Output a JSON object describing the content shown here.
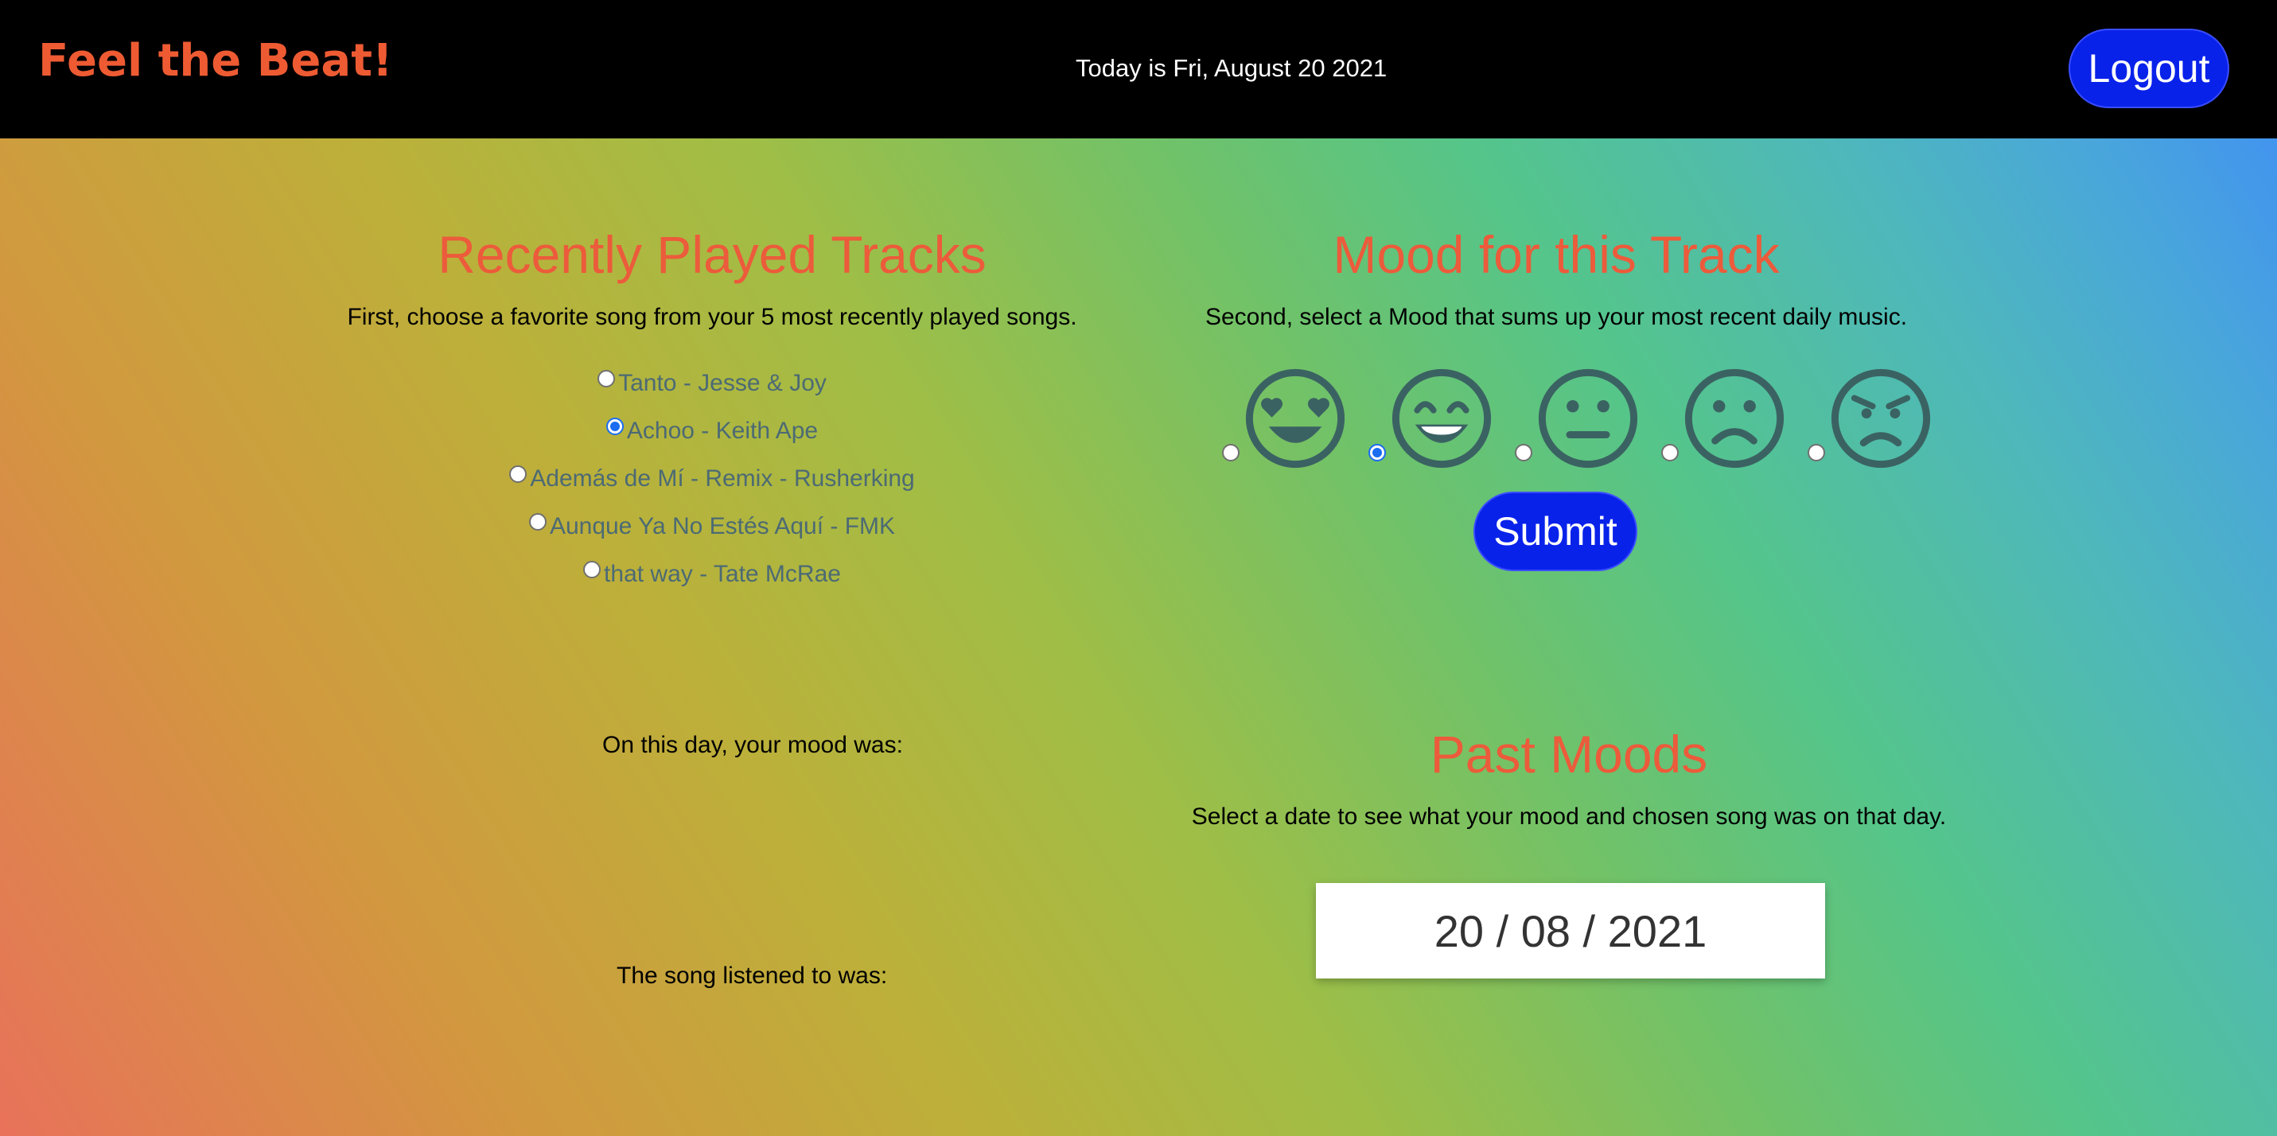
{
  "header": {
    "brand": "Feel the Beat!",
    "today_text": "Today is Fri, August 20 2021",
    "logout_label": "Logout"
  },
  "tracks_section": {
    "title": "Recently Played Tracks",
    "subtitle": "First, choose a favorite song from your 5 most recently played songs.",
    "tracks": [
      {
        "label": "Tanto - Jesse & Joy",
        "selected": false
      },
      {
        "label": "Achoo - Keith Ape",
        "selected": true
      },
      {
        "label": "Además de Mí - Remix - Rusherking",
        "selected": false
      },
      {
        "label": "Aunque Ya No Estés Aquí - FMK",
        "selected": false
      },
      {
        "label": "that way - Tate McRae",
        "selected": false
      }
    ]
  },
  "mood_section": {
    "title": "Mood for this Track",
    "subtitle": "Second, select a Mood that sums up your most recent daily music.",
    "moods": [
      {
        "icon": "heart-eyes-face-icon",
        "selected": false
      },
      {
        "icon": "grinning-face-icon",
        "selected": true
      },
      {
        "icon": "neutral-face-icon",
        "selected": false
      },
      {
        "icon": "frowning-face-icon",
        "selected": false
      },
      {
        "icon": "angry-face-icon",
        "selected": false
      }
    ],
    "submit_label": "Submit"
  },
  "past_moods": {
    "title": "Past Moods",
    "subtitle": "Select a date to see what your mood and chosen song was on that day.",
    "date_value": "20 / 08 / 2021",
    "mood_label": "On this day, your mood was:",
    "song_label": "The song listened to was:"
  },
  "colors": {
    "accent": "#ec5b3b",
    "button": "#0822ea",
    "emoji": "#3b6262",
    "radio_checked": "#1a6cf0"
  }
}
